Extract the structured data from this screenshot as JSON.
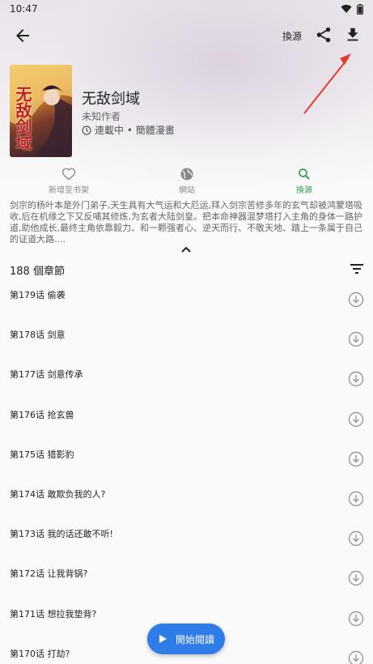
{
  "status_bar": {
    "time": "10:47"
  },
  "toolbar": {
    "source_label": "換源"
  },
  "manga": {
    "title": "无敌剑域",
    "author": "未知作者",
    "status": "連載中 • 簡體漫畫",
    "cover_text": "无敌剑域"
  },
  "actions": [
    {
      "label": "新增至书架",
      "icon": "heart-icon"
    },
    {
      "label": "網站",
      "icon": "globe-icon"
    },
    {
      "label": "換源",
      "icon": "search-icon"
    }
  ],
  "description": "剑宗的杨叶本是外门弟子,天生具有大气运和大厄运,拜入剑宗苦修多年的玄气却被鸿蒙塔吸收,后在机缘之下又反哺其修炼,为玄者大陆剑皇。把本命神器混梦塔打入主角的身体一路护道,助他成长,最终主角依靠毅力、和一颗强者心、逆天而行、不敬天地、踏上一条属于自己的证道大路....",
  "chapter_count": "188 個章節",
  "chapters": [
    "第179话 偷袭",
    "第178话 剑意",
    "第177话 剑意传承",
    "第176话 抢玄兽",
    "第175话 猎影豹",
    "第174话 敢欺负我的人?",
    "第173话 我的话还敢不听!",
    "第172话 让我背锅?",
    "第171话 想拉我垫背?",
    "第170话 打劫?"
  ],
  "fab": {
    "label": "開始閱讀"
  },
  "colors": {
    "accent_green": "#2e9d4a",
    "fab_blue": "#2f7ce8",
    "annotation_red": "#e23a2e"
  }
}
